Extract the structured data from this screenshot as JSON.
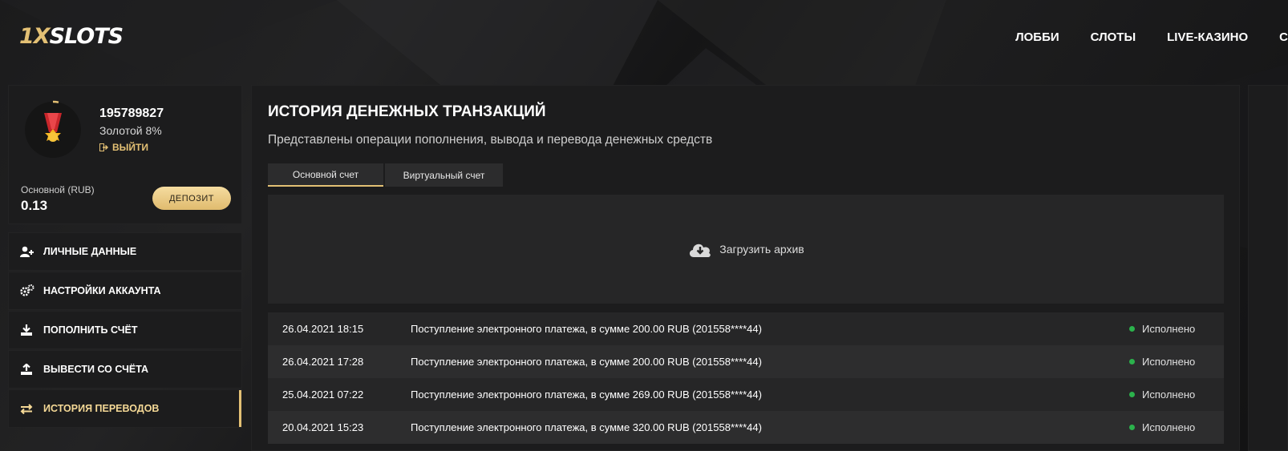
{
  "header": {
    "logo_prefix": "1X",
    "logo_suffix": "SLOTS",
    "nav": [
      "ЛОББИ",
      "СЛОТЫ",
      "LIVE-КАЗИНО",
      "С"
    ]
  },
  "profile": {
    "user_id": "195789827",
    "level": "Золотой 8%",
    "logout_label": "ВЫЙТИ",
    "balance_label": "Основной (RUB)",
    "balance_value": "0.13",
    "deposit_label": "ДЕПОЗИТ"
  },
  "menu": [
    {
      "label": "ЛИЧНЫЕ ДАННЫЕ",
      "icon": "user-plus-icon"
    },
    {
      "label": "НАСТРОЙКИ АККАУНТА",
      "icon": "gears-icon"
    },
    {
      "label": "ПОПОЛНИТЬ СЧЁТ",
      "icon": "download-icon"
    },
    {
      "label": "ВЫВЕСТИ СО СЧЁТА",
      "icon": "upload-icon"
    },
    {
      "label": "ИСТОРИЯ ПЕРЕВОДОВ",
      "icon": "transfer-arrows-icon",
      "active": true
    }
  ],
  "main": {
    "title": "ИСТОРИЯ ДЕНЕЖНЫХ ТРАНЗАКЦИЙ",
    "subtitle": "Представлены операции пополнения, вывода и перевода денежных средств",
    "tabs": [
      {
        "label": "Основной счет",
        "active": true
      },
      {
        "label": "Виртуальный счет",
        "active": false
      }
    ],
    "archive_label": "Загрузить архив",
    "transactions": [
      {
        "date": "26.04.2021 18:15",
        "description": "Поступление электронного платежа, в сумме 200.00 RUB (201558****44)",
        "status": "Исполнено"
      },
      {
        "date": "26.04.2021 17:28",
        "description": "Поступление электронного платежа, в сумме 200.00 RUB (201558****44)",
        "status": "Исполнено"
      },
      {
        "date": "25.04.2021 07:22",
        "description": "Поступление электронного платежа, в сумме 269.00 RUB (201558****44)",
        "status": "Исполнено"
      },
      {
        "date": "20.04.2021 15:23",
        "description": "Поступление электронного платежа, в сумме 320.00 RUB (201558****44)",
        "status": "Исполнено"
      }
    ]
  },
  "colors": {
    "accent_gold": "#e3c074",
    "status_green": "#2bb24c",
    "panel_bg": "#1c1c1d"
  }
}
